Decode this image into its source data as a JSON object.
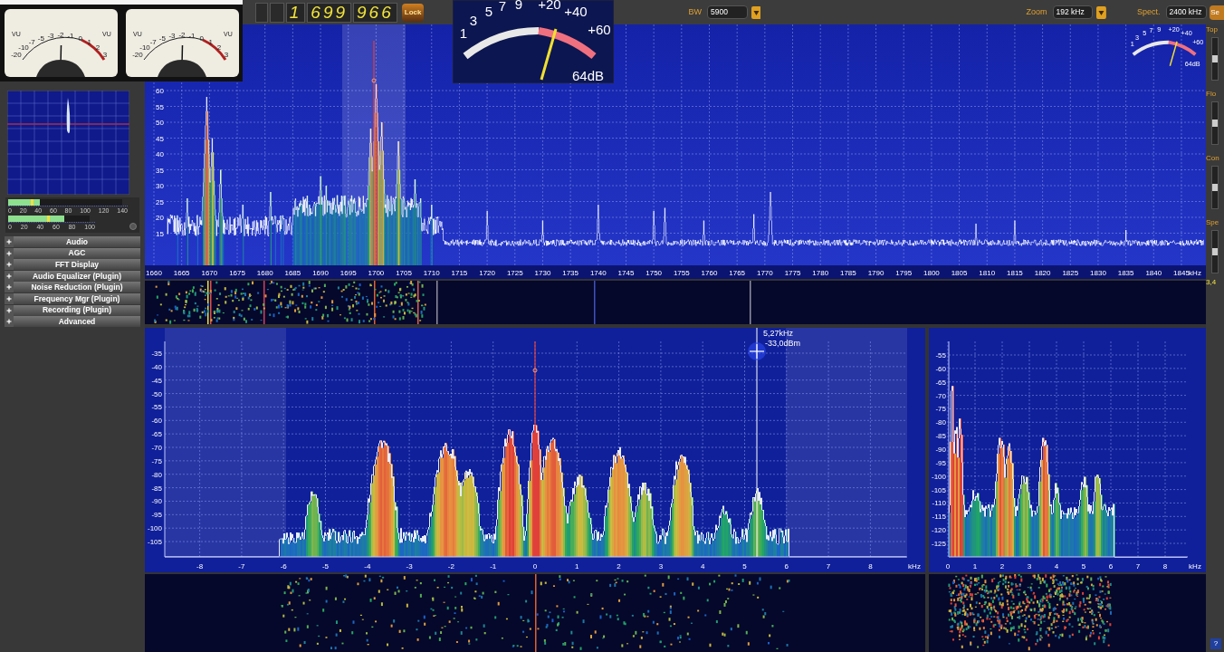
{
  "vu_meters": [
    {
      "label_left": "VU",
      "label_right": "VU",
      "scale": [
        "-20",
        "-10",
        "-7",
        "-5",
        "-3",
        "-2",
        "-1",
        "0",
        "1",
        "2",
        "3"
      ]
    },
    {
      "label_left": "VU",
      "label_right": "VU",
      "scale": [
        "-20",
        "-10",
        "-7",
        "-5",
        "-3",
        "-2",
        "-1",
        "0",
        "1",
        "2",
        "3"
      ]
    }
  ],
  "frequency": {
    "digits": [
      "1",
      "699",
      "966"
    ],
    "lock_button": "Lock"
  },
  "s_meter": {
    "scale": [
      "1",
      "3",
      "5",
      "7",
      "9",
      "+20",
      "+40",
      "+60"
    ],
    "reading": "64dB"
  },
  "bandwidth": {
    "label": "BW",
    "value": "5900"
  },
  "zoom": {
    "label": "Zoom",
    "value": "192 kHz"
  },
  "spectrum_width": {
    "label": "Spect.",
    "value": "2400 kHz"
  },
  "set_button": "Se",
  "level_meters": [
    {
      "level": 0.28,
      "scale": [
        "0",
        "20",
        "40",
        "60",
        "80",
        "100",
        "120",
        "140"
      ]
    },
    {
      "level": 0.69,
      "scale": [
        "0",
        "20",
        "40",
        "60",
        "80",
        "100"
      ]
    }
  ],
  "panels": [
    {
      "title": "Audio",
      "expanded": false
    },
    {
      "title": "AGC",
      "expanded": false
    },
    {
      "title": "FFT Display",
      "expanded": false
    },
    {
      "title": "Audio Equalizer (Plugin)",
      "expanded": false
    },
    {
      "title": "Noise Reduction (Plugin)",
      "expanded": false
    },
    {
      "title": "Frequency Mgr (Plugin)",
      "expanded": false
    },
    {
      "title": "Recording (Plugin)",
      "expanded": false
    },
    {
      "title": "Advanced",
      "expanded": false
    }
  ],
  "main_spectrum": {
    "y_labels": [
      "60",
      "55",
      "50",
      "45",
      "40",
      "35",
      "30",
      "25",
      "20",
      "15"
    ],
    "x_labels": [
      "1660",
      "1665",
      "1670",
      "1675",
      "1680",
      "1685",
      "1690",
      "1695",
      "1700",
      "1705",
      "1710",
      "1715",
      "1720",
      "1725",
      "1730",
      "1735",
      "1740",
      "1745",
      "1750",
      "1755",
      "1760",
      "1765",
      "1770",
      "1775",
      "1780",
      "1785",
      "1790",
      "1795",
      "1800",
      "1805",
      "1810",
      "1815",
      "1820",
      "1825",
      "1830",
      "1835",
      "1840",
      "1845"
    ],
    "unit": "kHz",
    "mini_meter": {
      "scale": [
        "1",
        "3",
        "5",
        "7",
        "9",
        "+20",
        "+40",
        "+60"
      ],
      "reading": "64dB"
    }
  },
  "side_controls": [
    "Top",
    "Flo",
    "Con",
    "Spe"
  ],
  "waterfall_speed": "3,4",
  "audio_spectrum": {
    "y_labels": [
      "-35",
      "-40",
      "-45",
      "-50",
      "-55",
      "-60",
      "-65",
      "-70",
      "-75",
      "-80",
      "-85",
      "-90",
      "-95",
      "-100",
      "-105"
    ],
    "x_labels": [
      "-8",
      "-7",
      "-6",
      "-5",
      "-4",
      "-3",
      "-2",
      "-1",
      "0",
      "1",
      "2",
      "3",
      "4",
      "5",
      "6",
      "7",
      "8"
    ],
    "unit": "kHz",
    "cursor": {
      "frequency": "5,27kHz",
      "power": "-33,0dBm"
    }
  },
  "audio_spectrum_zoomed": {
    "y_labels": [
      "-55",
      "-60",
      "-65",
      "-70",
      "-75",
      "-80",
      "-85",
      "-90",
      "-95",
      "-100",
      "-105",
      "-110",
      "-115",
      "-120",
      "-125"
    ],
    "x_labels": [
      "0",
      "1",
      "2",
      "3",
      "4",
      "5",
      "6",
      "7",
      "8"
    ],
    "unit": "kHz"
  },
  "help_button": "?"
}
